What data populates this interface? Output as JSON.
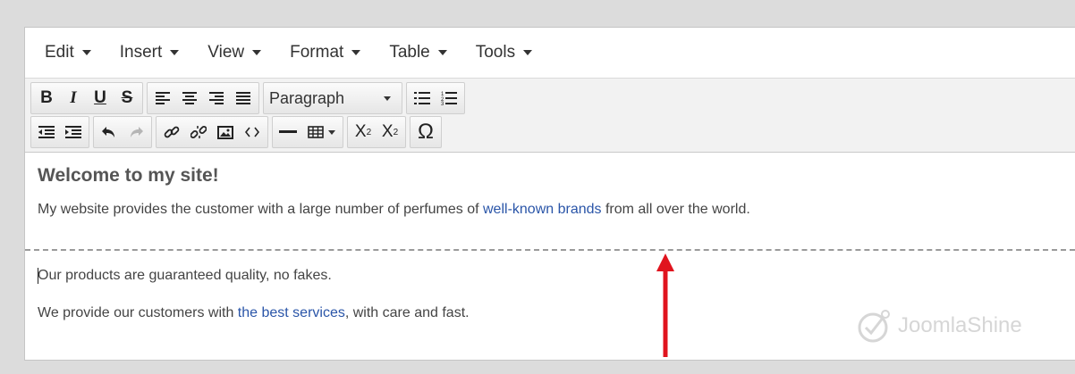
{
  "menubar": {
    "items": [
      {
        "label": "Edit"
      },
      {
        "label": "Insert"
      },
      {
        "label": "View"
      },
      {
        "label": "Format"
      },
      {
        "label": "Table"
      },
      {
        "label": "Tools"
      }
    ]
  },
  "toolbar": {
    "bold": "B",
    "italic": "I",
    "underline": "U",
    "strikethrough": "S",
    "format_select": "Paragraph",
    "subscript": "X",
    "subscript_sub": "2",
    "superscript": "X",
    "superscript_sup": "2",
    "special_char": "Ω"
  },
  "content": {
    "heading": "Welcome to my site!",
    "p1_before": "My website provides the customer with a large number of perfumes of ",
    "p1_link": "well-known brands",
    "p1_after": " from all over the world.",
    "p2": "Our products are guaranteed quality, no fakes.",
    "p3_before": "We provide our customers with ",
    "p3_link": "the best services",
    "p3_after": ", with care and fast."
  },
  "watermark": {
    "text": "JoomlaShine"
  },
  "colors": {
    "link": "#2a55a8",
    "arrow": "#e0141e",
    "toolbar_bg": "#f2f2f2"
  }
}
